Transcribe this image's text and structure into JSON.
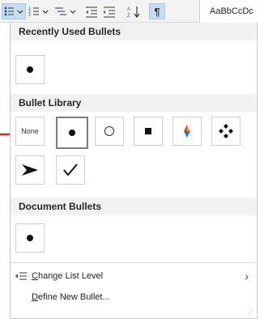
{
  "ribbon": {
    "style_preview": "AaBbCcDc",
    "paragraph_mark": "¶"
  },
  "bullets_menu": {
    "recent_header": "Recently Used Bullets",
    "library_header": "Bullet Library",
    "document_header": "Document Bullets",
    "none_label": "None",
    "change_list_level_prefix": "",
    "change_list_level_underlined": "C",
    "change_list_level_rest": "hange List Level",
    "define_new_underlined": "D",
    "define_new_rest": "efine New Bullet...",
    "submenu_chevron": "›",
    "library_items": [
      "none",
      "filled-dot",
      "hollow-circle",
      "filled-square",
      "four-color-diamond",
      "four-diamond-cluster",
      "arrowhead",
      "checkmark"
    ]
  },
  "colors": {
    "selected_tile_border": "#7d7d7d",
    "header_bg": "#f2f2f2",
    "annotation_arrow": "#d0281c"
  }
}
